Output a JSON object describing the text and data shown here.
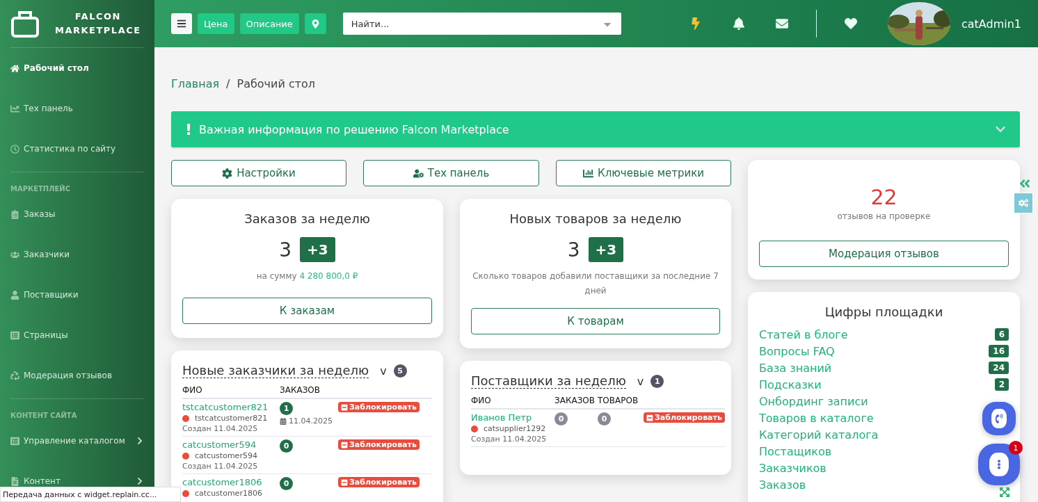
{
  "sidebar": {
    "brand": [
      "FALCON",
      "MARKETPLACE"
    ],
    "sections": [
      {
        "items": [
          {
            "label": "Рабочий стол",
            "selected": true
          },
          {
            "label": "Тех панель",
            "selected": false
          },
          {
            "label": "Статистика по сайту",
            "selected": false
          }
        ]
      },
      {
        "heading": "МАРКЕТПЛЕЙС",
        "items": [
          {
            "label": "Заказы",
            "selected": false
          },
          {
            "label": "Заказчики",
            "selected": false
          },
          {
            "label": "Поставщики",
            "selected": false
          },
          {
            "label": "Страницы",
            "selected": false
          },
          {
            "label": "Модерация отзывов",
            "selected": false
          }
        ]
      },
      {
        "heading": "КОНТЕНТ САЙТА",
        "items": [
          {
            "label": "Управление каталогом",
            "selected": false,
            "expandable": true
          },
          {
            "label": "Контент",
            "selected": false,
            "expandable": true
          }
        ]
      }
    ]
  },
  "topbar": {
    "buttons": [
      "Цена",
      "Описание"
    ],
    "search": {
      "placeholder": "Найти..."
    },
    "user": "catAdmin1"
  },
  "breadcrumb": {
    "link": "Главная",
    "separator": "/",
    "current": "Рабочий стол"
  },
  "alert": {
    "icon": "!",
    "text": "Важная информация по решению Falcon Marketplace",
    "expanded": false
  },
  "quick_buttons": [
    "Настройки",
    "Тех панель",
    "Ключевые метрики"
  ],
  "orders_card": {
    "title": "Заказов за неделю",
    "count": "3",
    "delta": "+3",
    "sum_label": "на сумму",
    "sum": "4 280 800,0 ₽",
    "button": "К заказам"
  },
  "products_card": {
    "title": "Новых товаров за неделю",
    "count": "3",
    "delta": "+3",
    "note": "Сколько товаров добавили поставщики за последние 7 дней",
    "button": "К товарам"
  },
  "customers_card": {
    "title": "Новые заказчики за неделю",
    "toggle": "v",
    "total": "5",
    "columns": [
      "ФИО",
      "ЗАКАЗОВ"
    ],
    "rows": [
      {
        "name": "tstcatcustomer821",
        "online": false,
        "login": "tstcatcustomer821",
        "created": "Создан 11.04.2025",
        "orders": "1",
        "last_order": "11.04.2025",
        "action": "Заблокировать"
      },
      {
        "name": "catcustomer594",
        "online": false,
        "login": "catcustomer594",
        "created": "Создан 11.04.2025",
        "orders": "0",
        "action": "Заблокировать"
      },
      {
        "name": "catcustomer1806",
        "online": false,
        "login": "catcustomer1806",
        "orders": "0",
        "action": "Заблокировать"
      }
    ]
  },
  "suppliers_card": {
    "title": "Поставщики за неделю",
    "toggle": "v",
    "total": "1",
    "columns": [
      "ФИО",
      "ЗАКАЗОВ",
      "ТОВАРОВ"
    ],
    "rows": [
      {
        "name": "Иванов Петр",
        "online": false,
        "login": "catsupplier1292",
        "created": "Создан 11.04.2025",
        "orders": "0",
        "products": "0",
        "action": "Заблокировать"
      }
    ]
  },
  "reviews_card": {
    "count": "22",
    "label": "отзывов на проверке",
    "button": "Модерация отзывов"
  },
  "stats_card": {
    "title": "Цифры площадки",
    "rows": [
      {
        "label": "Статей в блоге",
        "value": "6"
      },
      {
        "label": "Вопросы FAQ",
        "value": "16"
      },
      {
        "label": "База знаний",
        "value": "24"
      },
      {
        "label": "Подсказки",
        "value": "2"
      },
      {
        "label": "Онбординг записи"
      },
      {
        "label": "Товаров в каталоге"
      },
      {
        "label": "Категорий каталога"
      },
      {
        "label": "Постащиков"
      },
      {
        "label": "Заказчиков"
      },
      {
        "label": "Заказов"
      }
    ]
  },
  "chat_widget": {
    "unread": "1"
  },
  "status_bar": "Передача данных с widget.replain.cc..."
}
